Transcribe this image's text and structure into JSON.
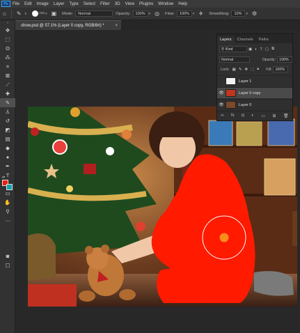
{
  "menubar": {
    "logo": "Ps",
    "items": [
      "File",
      "Edit",
      "Image",
      "Layer",
      "Type",
      "Select",
      "Filter",
      "3D",
      "View",
      "Plugins",
      "Window",
      "Help"
    ]
  },
  "options": {
    "home_icon": "home-icon",
    "brush_size": "338",
    "mode_label": "Mode:",
    "mode_value": "Normal",
    "opacity_label": "Opacity:",
    "opacity_value": "100%",
    "flow_label": "Flow:",
    "flow_value": "100%",
    "smoothing_label": "Smoothing:",
    "smoothing_value": "10%"
  },
  "document": {
    "tab_title": "show.psd @ 57.1% (Layer 0 copy, RGB/8#) *",
    "tab_close": "×"
  },
  "colors": {
    "foreground": "#ee1d0f",
    "background": "#14a3a8",
    "brush_dot": "#ff8c1a"
  },
  "layers_panel": {
    "tabs": [
      "Layers",
      "Channels",
      "Paths"
    ],
    "filter_value": "Kind",
    "blend_mode": "Normal",
    "opacity_label": "Opacity:",
    "opacity_value": "100%",
    "lock_label": "Lock:",
    "fill_label": "Fill:",
    "fill_value": "100%",
    "layers": [
      {
        "name": "Layer 1",
        "visible": false,
        "selected": false,
        "thumb": "#f2f2f2"
      },
      {
        "name": "Layer 0 copy",
        "visible": true,
        "selected": true,
        "thumb": "#c0361e"
      },
      {
        "name": "Layer 0",
        "visible": true,
        "selected": false,
        "thumb": "#7a4a2a"
      }
    ],
    "footer_icons": [
      "link-icon",
      "fx-icon",
      "mask-icon",
      "adjustment-icon",
      "group-icon",
      "new-layer-icon",
      "trash-icon"
    ]
  }
}
